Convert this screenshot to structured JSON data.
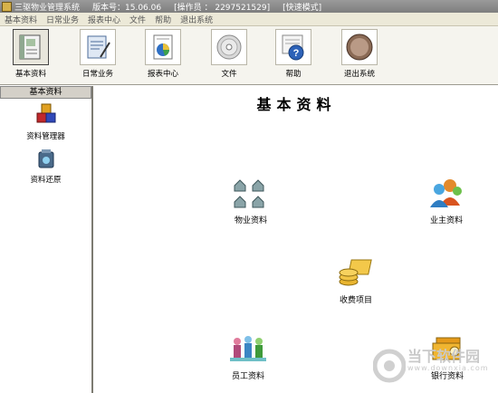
{
  "titlebar": {
    "app_name": "三驱物业管理系统",
    "version": "版本号：15.06.06",
    "operator": "[操作员 ： 2297521529]",
    "mode": "[快速模式]"
  },
  "menu": [
    "基本资料",
    "日常业务",
    "报表中心",
    "文件",
    "帮助",
    "退出系统"
  ],
  "toolbar": [
    {
      "label": "基本资料",
      "icon": "book-icon"
    },
    {
      "label": "日常业务",
      "icon": "notepad-icon"
    },
    {
      "label": "报表中心",
      "icon": "pie-report-icon"
    },
    {
      "label": "文件",
      "icon": "disc-icon"
    },
    {
      "label": "帮助",
      "icon": "help-icon"
    },
    {
      "label": "退出系统",
      "icon": "exit-icon"
    }
  ],
  "left_panel": {
    "header": "基本资料",
    "items": [
      {
        "label": "资料管理器",
        "icon": "cubes-icon"
      },
      {
        "label": "资料还原",
        "icon": "restore-icon"
      }
    ]
  },
  "main": {
    "title": "基本资料",
    "modules": [
      {
        "label": "物业资料",
        "icon": "houses-icon"
      },
      {
        "label": "业主资料",
        "icon": "users-icon"
      },
      {
        "label": "收费项目",
        "icon": "coins-icon"
      },
      {
        "label": "员工资料",
        "icon": "staff-icon"
      },
      {
        "label": "银行资料",
        "icon": "bank-icon"
      }
    ]
  },
  "watermark": {
    "text": "当下软件园",
    "url": "www.downxia.com"
  }
}
